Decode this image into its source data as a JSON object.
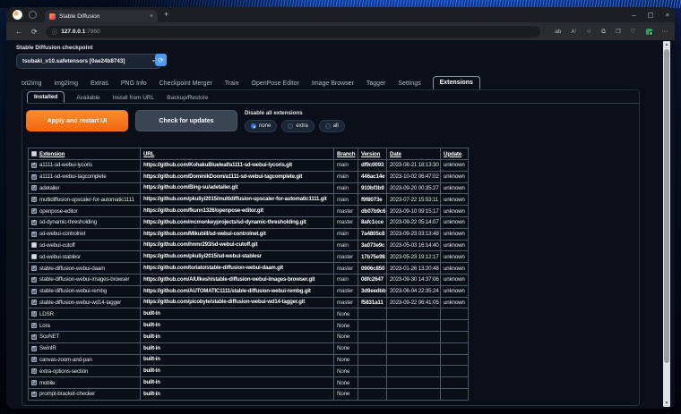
{
  "colors": {
    "accent_orange": "#f1670e",
    "accent_blue": "#4b9bf5",
    "radio_selected_blue": "#2f6df6",
    "page_bg": "#0b0f19"
  },
  "browser": {
    "tab": {
      "title": "Stable Diffusion",
      "close_glyph": "×",
      "favicon": "stable-diffusion-favicon"
    },
    "new_tab_glyph": "+",
    "nav": {
      "back_glyph": "←",
      "refresh_glyph": "⟳",
      "info_glyph": "ⓘ"
    },
    "address": {
      "host": "127.0.0.1",
      "port": ":7860"
    },
    "toolbar_icons": [
      {
        "name": "immersive-reader-icon",
        "glyph": "ab"
      },
      {
        "name": "read-aloud-icon",
        "glyph": "A⁾"
      },
      {
        "name": "favorites-icon",
        "glyph": "☆"
      },
      {
        "name": "split-screen-icon",
        "glyph": "⧉"
      },
      {
        "name": "collections-icon",
        "glyph": "❐"
      },
      {
        "name": "browser-essentials-icon",
        "glyph": "♡"
      },
      {
        "name": "adblock-extension-icon",
        "glyph": "",
        "green": true
      },
      {
        "name": "more-menu-icon",
        "glyph": "⋯"
      }
    ],
    "window_controls": [
      {
        "name": "minimize-button",
        "glyph": "–"
      },
      {
        "name": "maximize-button",
        "glyph": "▢"
      },
      {
        "name": "close-button",
        "glyph": "×"
      }
    ]
  },
  "app": {
    "checkpoint_label": "Stable Diffusion checkpoint",
    "checkpoint_value": "tsubaki_v10.safetensors [0ae24b8743]",
    "caret_glyph": "▾",
    "refresh_glyph": "⟳",
    "main_tabs": [
      "txt2img",
      "img2img",
      "Extras",
      "PNG Info",
      "Checkpoint Merger",
      "Train",
      "OpenPose Editor",
      "Image Browser",
      "Tagger",
      "Settings",
      "Extensions"
    ],
    "active_main_tab": "Extensions",
    "sub_tabs": [
      "Installed",
      "Available",
      "Install from URL",
      "Backup/Restore"
    ],
    "active_sub_tab": "Installed",
    "actions": {
      "apply": "Apply and restart UI",
      "check": "Check for updates",
      "disable_label": "Disable all extensions",
      "radios": [
        "none",
        "extra",
        "all"
      ],
      "radio_selected": "none"
    },
    "table": {
      "header_checkbox_checked": false,
      "headers": [
        "Extension",
        "URL",
        "Branch",
        "Version",
        "Date",
        "Update"
      ],
      "rows": [
        {
          "checked": true,
          "name": "a1111-sd-webui-lycoris",
          "url": "https://github.com/KohakuBlueleaf/a1111-sd-webui-lycoris.git",
          "branch": "main",
          "version": "df9c0093",
          "date": "2023-08-21 18:13:30",
          "update": "unknown"
        },
        {
          "checked": true,
          "name": "a1111-sd-webui-tagcomplete",
          "url": "https://github.com/DominikDoom/a1111-sd-webui-tagcomplete.git",
          "branch": "main",
          "version": "446ac14e",
          "date": "2023-10-02 06:47:02",
          "update": "unknown"
        },
        {
          "checked": true,
          "name": "adetailer",
          "url": "https://github.com/Bing-su/adetailer.git",
          "branch": "main",
          "version": "910bf3b9",
          "date": "2023-09-20 00:35:27",
          "update": "unknown"
        },
        {
          "checked": true,
          "name": "multidiffusion-upscaler-for-automatic1111",
          "url": "https://github.com/pkuliyi2015/multidiffusion-upscaler-for-automatic1111.git",
          "branch": "main",
          "version": "f9f8073e",
          "date": "2023-07-22 15:53:11",
          "update": "unknown"
        },
        {
          "checked": true,
          "name": "openpose-editor",
          "url": "https://github.com/fkunn1326/openpose-editor.git",
          "branch": "master",
          "version": "db07b9c6",
          "date": "2023-09-10 09:15:17",
          "update": "unknown"
        },
        {
          "checked": true,
          "name": "sd-dynamic-thresholding",
          "url": "https://github.com/mcmonkeyprojects/sd-dynamic-thresholding.git",
          "branch": "master",
          "version": "8afc1cce",
          "date": "2023-09-22 05:14:07",
          "update": "unknown"
        },
        {
          "checked": true,
          "name": "sd-webui-controlnet",
          "url": "https://github.com/Mikubill/sd-webui-controlnet.git",
          "branch": "main",
          "version": "7a4805c8",
          "date": "2023-09-23 03:13:48",
          "update": "unknown"
        },
        {
          "checked": false,
          "name": "sd-webui-cutoff",
          "url": "https://github.com/hnmr293/sd-webui-cutoff.git",
          "branch": "main",
          "version": "3a073e9c",
          "date": "2023-05-03 16:14:40",
          "update": "unknown"
        },
        {
          "checked": false,
          "name": "sd-webui-stablesr",
          "url": "https://github.com/pkuliyi2015/sd-webui-stablesr",
          "branch": "master",
          "version": "17b75e98",
          "date": "2023-05-23 19:12:17",
          "update": "unknown"
        },
        {
          "checked": true,
          "name": "stable-diffusion-webui-daam",
          "url": "https://github.com/toriato/stable-diffusion-webui-daam.git",
          "branch": "master",
          "version": "0906c850",
          "date": "2023-01-26 13:20:48",
          "update": "unknown"
        },
        {
          "checked": true,
          "name": "stable-diffusion-webui-images-browser",
          "url": "https://github.com/AlUlkesh/stable-diffusion-webui-images-browser.git",
          "branch": "main",
          "version": "08fc2647",
          "date": "2023-09-30 14:37:06",
          "update": "unknown"
        },
        {
          "checked": true,
          "name": "stable-diffusion-webui-rembg",
          "url": "https://github.com/AUTOMATIC1111/stable-diffusion-webui-rembg.git",
          "branch": "master",
          "version": "3d9eedbb",
          "date": "2023-06-04 22:35:24",
          "update": "unknown"
        },
        {
          "checked": true,
          "name": "stable-diffusion-webui-wd14-tagger",
          "url": "https://github.com/picobyte/stable-diffusion-webui-wd14-tagger.git",
          "branch": "master",
          "version": "f5831a11",
          "date": "2023-09-22 06:41:05",
          "update": "unknown"
        },
        {
          "checked": true,
          "name": "LDSR",
          "url": "built-in",
          "branch": "None",
          "version": "",
          "date": "",
          "update": ""
        },
        {
          "checked": true,
          "name": "Lora",
          "url": "built-in",
          "branch": "None",
          "version": "",
          "date": "",
          "update": ""
        },
        {
          "checked": true,
          "name": "ScuNET",
          "url": "built-in",
          "branch": "None",
          "version": "",
          "date": "",
          "update": ""
        },
        {
          "checked": true,
          "name": "SwinIR",
          "url": "built-in",
          "branch": "None",
          "version": "",
          "date": "",
          "update": ""
        },
        {
          "checked": true,
          "name": "canvas-zoom-and-pan",
          "url": "built-in",
          "branch": "None",
          "version": "",
          "date": "",
          "update": ""
        },
        {
          "checked": true,
          "name": "extra-options-section",
          "url": "built-in",
          "branch": "None",
          "version": "",
          "date": "",
          "update": ""
        },
        {
          "checked": true,
          "name": "mobile",
          "url": "built-in",
          "branch": "None",
          "version": "",
          "date": "",
          "update": ""
        },
        {
          "checked": true,
          "name": "prompt-bracket-checker",
          "url": "built-in",
          "branch": "None",
          "version": "",
          "date": "",
          "update": ""
        }
      ]
    }
  }
}
